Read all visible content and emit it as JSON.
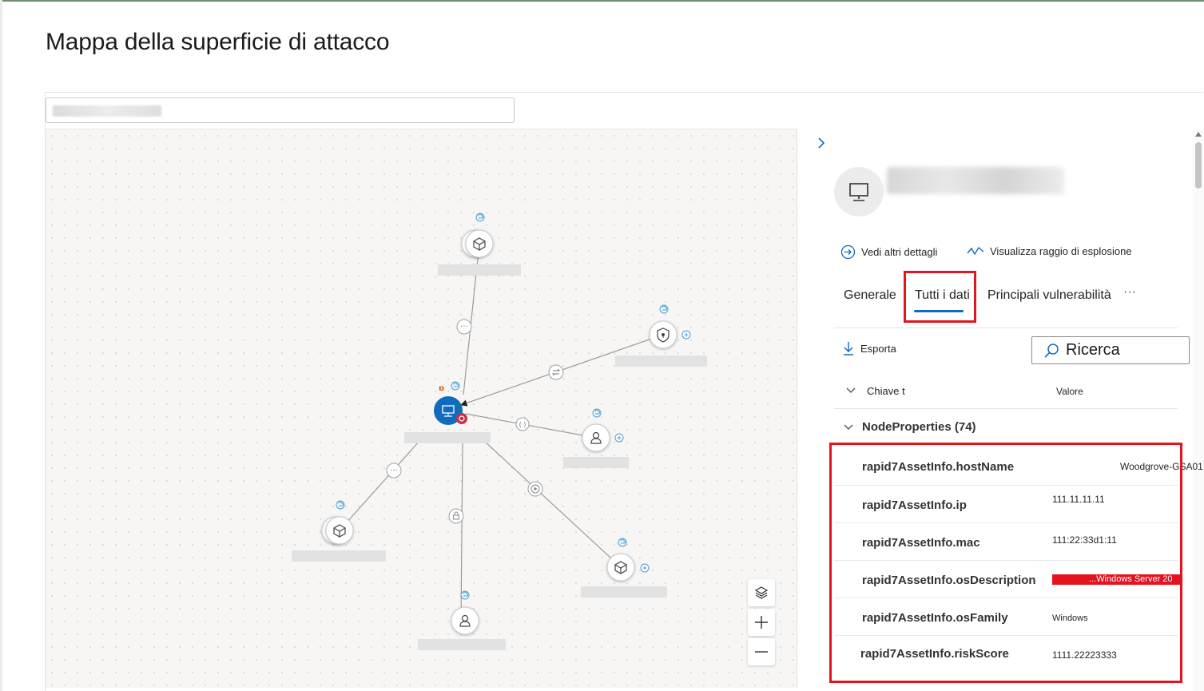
{
  "page": {
    "title": "Mappa della superficie di attacco"
  },
  "panel": {
    "actions": {
      "details": "Vedi altri dettagli",
      "blast": "Visualizza raggio di esplosione"
    },
    "tabs": [
      "Generale",
      "Tutti i dati",
      "Principali vulnerabilità",
      "···"
    ],
    "active_tab": "Tutti i dati",
    "export_label": "Esporta",
    "search_label": "Ricerca",
    "columns": {
      "key": "Chiave t",
      "value": "Valore"
    },
    "group": "NodeProperties (74)",
    "properties": [
      {
        "key": "rapid7AssetInfo.hostName",
        "value": "Woodgrove-GSA01"
      },
      {
        "key": "rapid7AssetInfo.ip",
        "value": "111.11.11.11"
      },
      {
        "key": "rapid7AssetInfo.mac",
        "value": "111:22:33d1:11"
      },
      {
        "key": "rapid7AssetInfo.osDescription",
        "value": "...Windows Server 20"
      },
      {
        "key": "rapid7AssetInfo.osFamily",
        "value": "Windows"
      },
      {
        "key": "rapid7AssetInfo.riskScore",
        "value": "1111.22223333"
      }
    ]
  },
  "colors": {
    "accent": "#0f6cbd",
    "highlight": "#e3131f",
    "node_center": "#0f6cbd"
  },
  "icons": [
    "chevron-right-icon",
    "computer-icon",
    "arrow-right-circle-icon",
    "blast-radius-icon",
    "download-icon",
    "search-icon",
    "chevron-down-icon",
    "layers-icon",
    "zoom-in-icon",
    "zoom-out-icon",
    "cube-icon",
    "shield-icon",
    "person-icon",
    "lock-icon",
    "more-icon",
    "swap-icon",
    "play-icon",
    "cloud-icon",
    "plus-circle-icon",
    "bug-icon"
  ]
}
